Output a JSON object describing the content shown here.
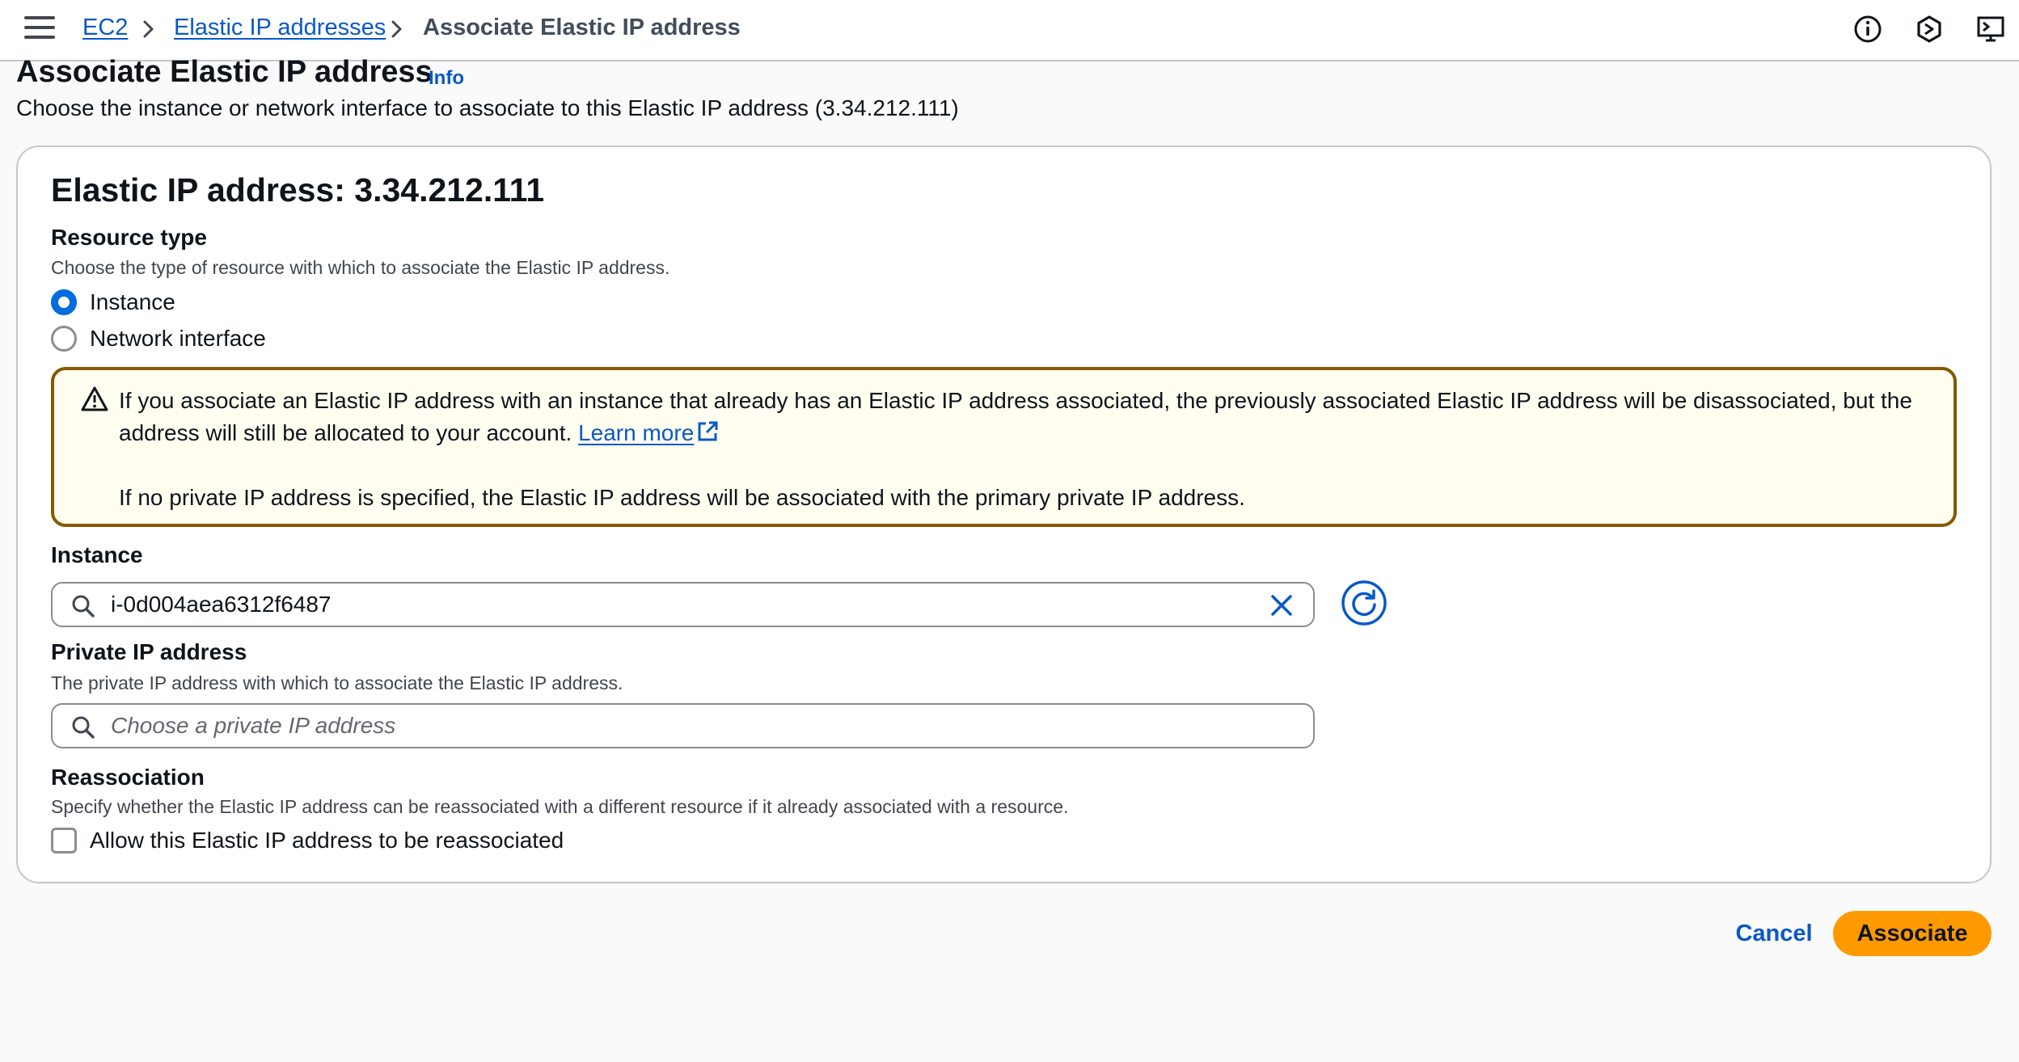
{
  "breadcrumb": {
    "items": [
      {
        "label": "EC2"
      },
      {
        "label": "Elastic IP addresses"
      }
    ],
    "current": "Associate Elastic IP address"
  },
  "header": {
    "title": "Associate Elastic IP address",
    "info_label": "Info",
    "description": "Choose the instance or network interface to associate to this Elastic IP address (3.34.212.111)"
  },
  "form": {
    "title": "Elastic IP address: 3.34.212.111",
    "resource_type": {
      "label": "Resource type",
      "description": "Choose the type of resource with which to associate the Elastic IP address.",
      "options": [
        {
          "label": "Instance",
          "selected": true
        },
        {
          "label": "Network interface",
          "selected": false
        }
      ]
    },
    "alert": {
      "line1": "If you associate an Elastic IP address with an instance that already has an Elastic IP address associated, the previously associated Elastic IP address will be disassociated, but the address will still be allocated to your account.",
      "link": "Learn more",
      "line2": "If no private IP address is specified, the Elastic IP address will be associated with the primary private IP address."
    },
    "instance": {
      "label": "Instance",
      "value": "i-0d004aea6312f6487"
    },
    "private_ip": {
      "label": "Private IP address",
      "description": "The private IP address with which to associate the Elastic IP address.",
      "placeholder": "Choose a private IP address"
    },
    "reassociation": {
      "label": "Reassociation",
      "description": "Specify whether the Elastic IP address can be reassociated with a different resource if it already associated with a resource.",
      "checkbox_label": "Allow this Elastic IP address to be reassociated",
      "checked": false
    }
  },
  "actions": {
    "cancel": "Cancel",
    "submit": "Associate"
  },
  "colors": {
    "link": "#0958c9",
    "primary": "#ff9900",
    "radio_selected": "#006ce0",
    "warning_border": "#855900",
    "warning_bg": "#fffef0"
  },
  "icons": [
    "menu-icon",
    "chevron-right-icon",
    "info-circle-icon",
    "settings-hexagon-icon",
    "cloudshell-icon",
    "warning-icon",
    "external-link-icon",
    "search-icon",
    "close-icon",
    "refresh-icon"
  ]
}
